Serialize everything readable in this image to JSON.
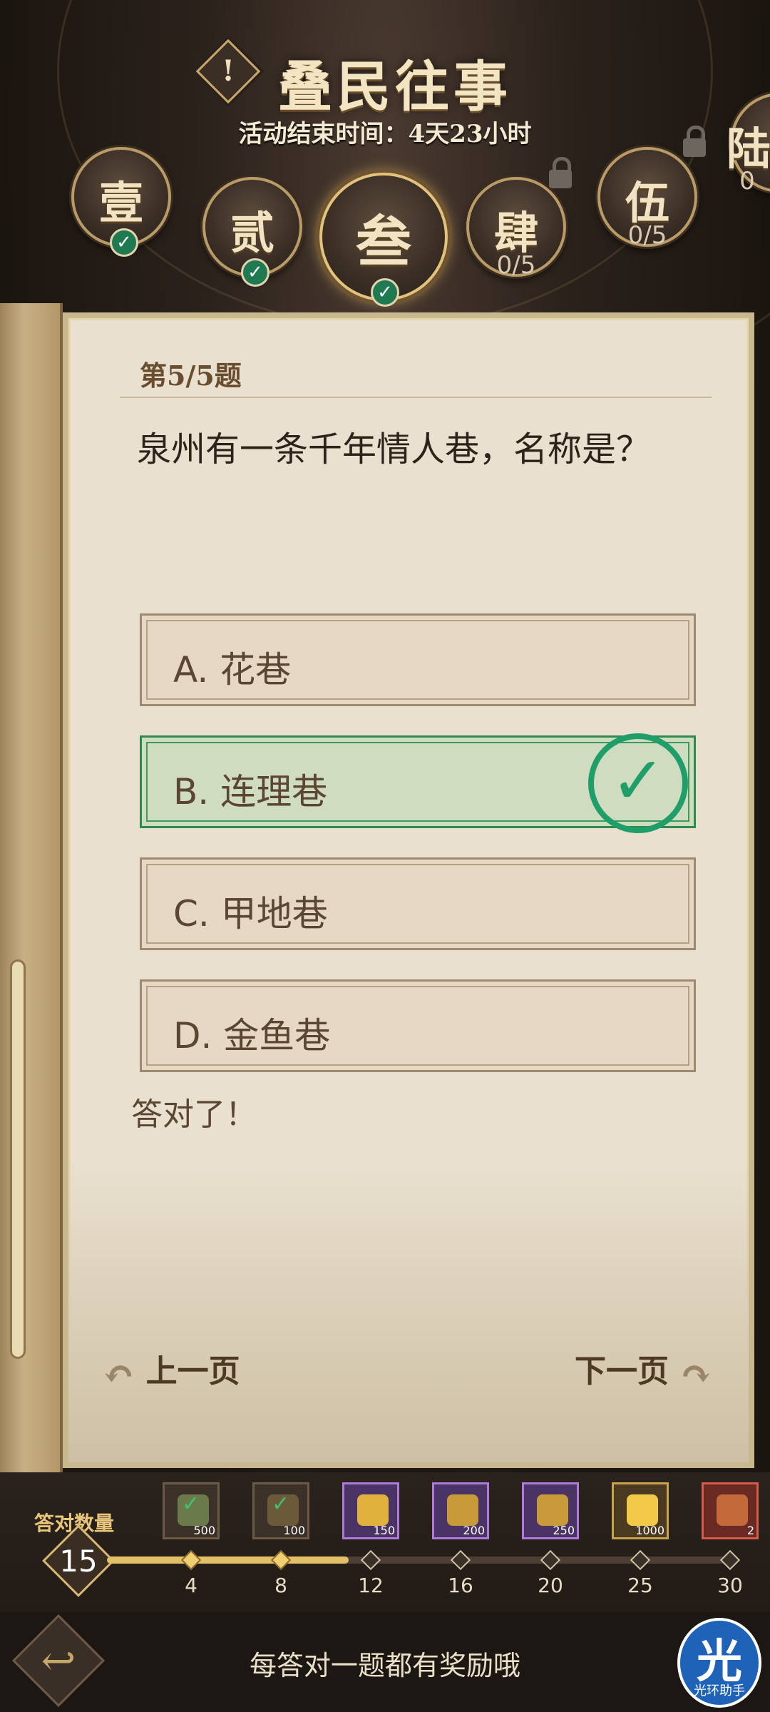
{
  "header": {
    "title": "叠民往事",
    "info_icon": "!",
    "subtitle": "活动结束时间：4天23小时"
  },
  "tabs": [
    {
      "glyph": "壹",
      "status": "completed"
    },
    {
      "glyph": "贰",
      "status": "completed"
    },
    {
      "glyph": "叁",
      "status": "completed",
      "selected": true
    },
    {
      "glyph": "肆",
      "progress": "0/5",
      "status": "locked"
    },
    {
      "glyph": "伍",
      "progress": "0/5",
      "status": "locked"
    },
    {
      "glyph": "陆",
      "progress": "0",
      "status": "locked"
    }
  ],
  "quiz": {
    "question_number": "第5/5题",
    "question": "泉州有一条千年情人巷，名称是？",
    "options": [
      {
        "label": "A. 花巷",
        "correct": false
      },
      {
        "label": "B. 连理巷",
        "correct": true
      },
      {
        "label": "C. 甲地巷",
        "correct": false
      },
      {
        "label": "D. 金鱼巷",
        "correct": false
      }
    ],
    "result": "答对了！",
    "prev_label": "上一页",
    "next_label": "下一页"
  },
  "rewards": {
    "count_label": "答对数量",
    "count_value": "15",
    "progress_fraction": 0.385,
    "milestones": [
      "4",
      "8",
      "12",
      "16",
      "20",
      "25",
      "30"
    ],
    "items": [
      {
        "amount": "500",
        "claimed": true,
        "color": "#6b7a4a"
      },
      {
        "amount": "100",
        "claimed": true,
        "color": "#6b5a3a"
      },
      {
        "amount": "150",
        "claimed": false,
        "color": "#e0b13c"
      },
      {
        "amount": "200",
        "claimed": false,
        "color": "#c99a3a"
      },
      {
        "amount": "250",
        "claimed": false,
        "color": "#c99a3a"
      },
      {
        "amount": "1000",
        "claimed": false,
        "color": "#f2c949"
      },
      {
        "amount": "2",
        "claimed": false,
        "color": "#c46a3a"
      }
    ]
  },
  "footer": {
    "hint": "每答对一题都有奖励哦",
    "helper_glyph": "光",
    "helper_text": "光环助手"
  },
  "colors": {
    "accent_gold": "#d8b775",
    "correct_green": "#1f9e6a",
    "paper": "#e9e0cf"
  }
}
